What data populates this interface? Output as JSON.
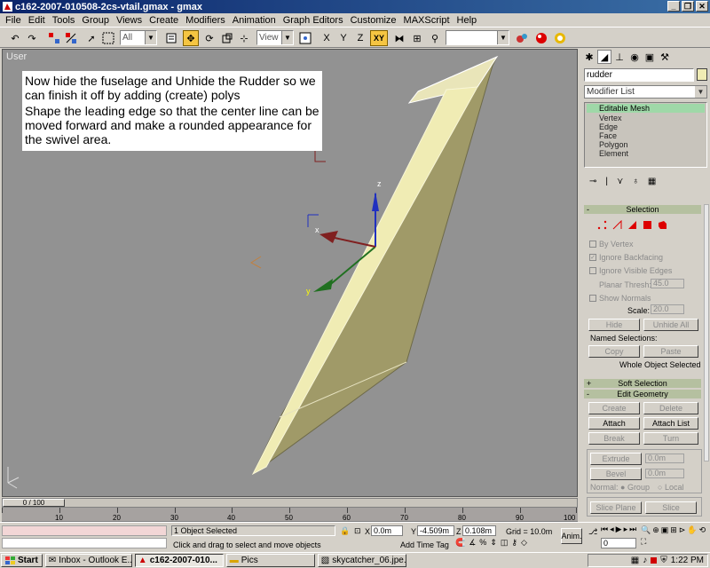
{
  "window": {
    "title": "c162-2007-010508-2cs-vtail.gmax - gmax",
    "buttons": {
      "minimize": "_",
      "restore": "❐",
      "close": "✕"
    }
  },
  "menu": [
    "File",
    "Edit",
    "Tools",
    "Group",
    "Views",
    "Create",
    "Modifiers",
    "Animation",
    "Graph Editors",
    "Customize",
    "MAXScript",
    "Help"
  ],
  "toolbar": {
    "selection_filter": "All",
    "ref_coord": "View",
    "axis_constraint": "XY",
    "named_sel_set": ""
  },
  "viewport": {
    "label": "User",
    "note_lines": [
      "Now hide the fuselage and Unhide the Rudder so we can finish it off by adding (create) polys",
      "Shape the leading edge so that the center line can be moved forward and make a rounded appearance for the swivel area."
    ],
    "gizmo": {
      "z": "z",
      "x": "x",
      "y": "y"
    }
  },
  "command_panel": {
    "object_name": "rudder",
    "modifier_list": "Modifier List",
    "stack": {
      "base": "Editable Mesh",
      "subobjects": [
        "Vertex",
        "Edge",
        "Face",
        "Polygon",
        "Element"
      ]
    },
    "selection_rollout": {
      "title": "Selection",
      "by_vertex": "By Vertex",
      "ignore_backfacing": "Ignore Backfacing",
      "ignore_visible_edges": "Ignore Visible Edges",
      "planar_thresh_label": "Planar Thresh:",
      "planar_thresh_value": "45.0",
      "show_normals": "Show Normals",
      "scale_label": "Scale:",
      "scale_value": "20.0",
      "hide": "Hide",
      "unhide_all": "Unhide All",
      "named_selections": "Named Selections:",
      "copy": "Copy",
      "paste": "Paste",
      "status": "Whole Object Selected"
    },
    "soft_selection": "Soft Selection",
    "edit_geometry": {
      "title": "Edit Geometry",
      "create": "Create",
      "delete": "Delete",
      "attach": "Attach",
      "attach_list": "Attach List",
      "break": "Break",
      "turn": "Turn",
      "extrude": "Extrude",
      "extrude_value": "0.0m",
      "bevel": "Bevel",
      "bevel_value": "0.0m",
      "normal_label": "Normal:",
      "group": "Group",
      "local": "Local",
      "slice_plane": "Slice Plane",
      "slice": "Slice"
    }
  },
  "timeline": {
    "frame": "0 / 100",
    "ticks": [
      "10",
      "20",
      "30",
      "40",
      "50",
      "60",
      "70",
      "80",
      "90",
      "100"
    ]
  },
  "status": {
    "selected": "1 Object Selected",
    "prompt": "Click and drag to select and move objects",
    "x_label": "X",
    "x_value": "0.0m",
    "y_label": "Y",
    "y_value": "-4.509m",
    "z_label": "Z",
    "z_value": "0.108m",
    "grid": "Grid = 10.0m",
    "add_time_tag": "Add Time Tag",
    "anim": "Anim.",
    "frame_input": "0"
  },
  "taskbar": {
    "start": "Start",
    "tasks": [
      "Inbox - Outlook E...",
      "c162-2007-010...",
      "Pics",
      "skycatcher_06.jpe..."
    ],
    "time": "1:22 PM"
  },
  "colors": {
    "title_bar": "#0a246a",
    "viewport_bg": "#929292",
    "rudder_face": "#a09a68",
    "rudder_edge": "#f0ecb4",
    "rollout_header": "#b5c0a0",
    "active_tool": "#f5c542"
  }
}
